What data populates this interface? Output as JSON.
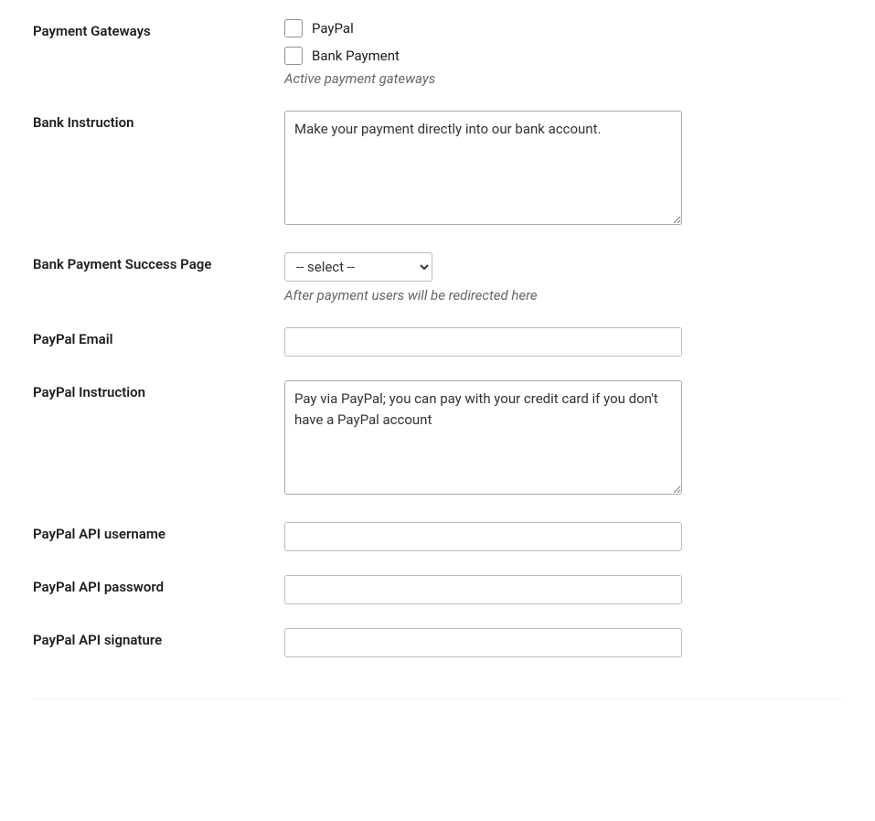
{
  "fields": {
    "payment_gateways": {
      "label": "Payment Gateways",
      "options": {
        "paypal": "PayPal",
        "bank": "Bank Payment"
      },
      "description": "Active payment gateways"
    },
    "bank_instruction": {
      "label": "Bank Instruction",
      "value": "Make your payment directly into our bank account."
    },
    "bank_success_page": {
      "label": "Bank Payment Success Page",
      "selected": "-- select --",
      "description": "After payment users will be redirected here"
    },
    "paypal_email": {
      "label": "PayPal Email",
      "value": ""
    },
    "paypal_instruction": {
      "label": "PayPal Instruction",
      "value": "Pay via PayPal; you can pay with your credit card if you don't have a PayPal account"
    },
    "paypal_api_username": {
      "label": "PayPal API username",
      "value": ""
    },
    "paypal_api_password": {
      "label": "PayPal API password",
      "value": ""
    },
    "paypal_api_signature": {
      "label": "PayPal API signature",
      "value": ""
    }
  }
}
